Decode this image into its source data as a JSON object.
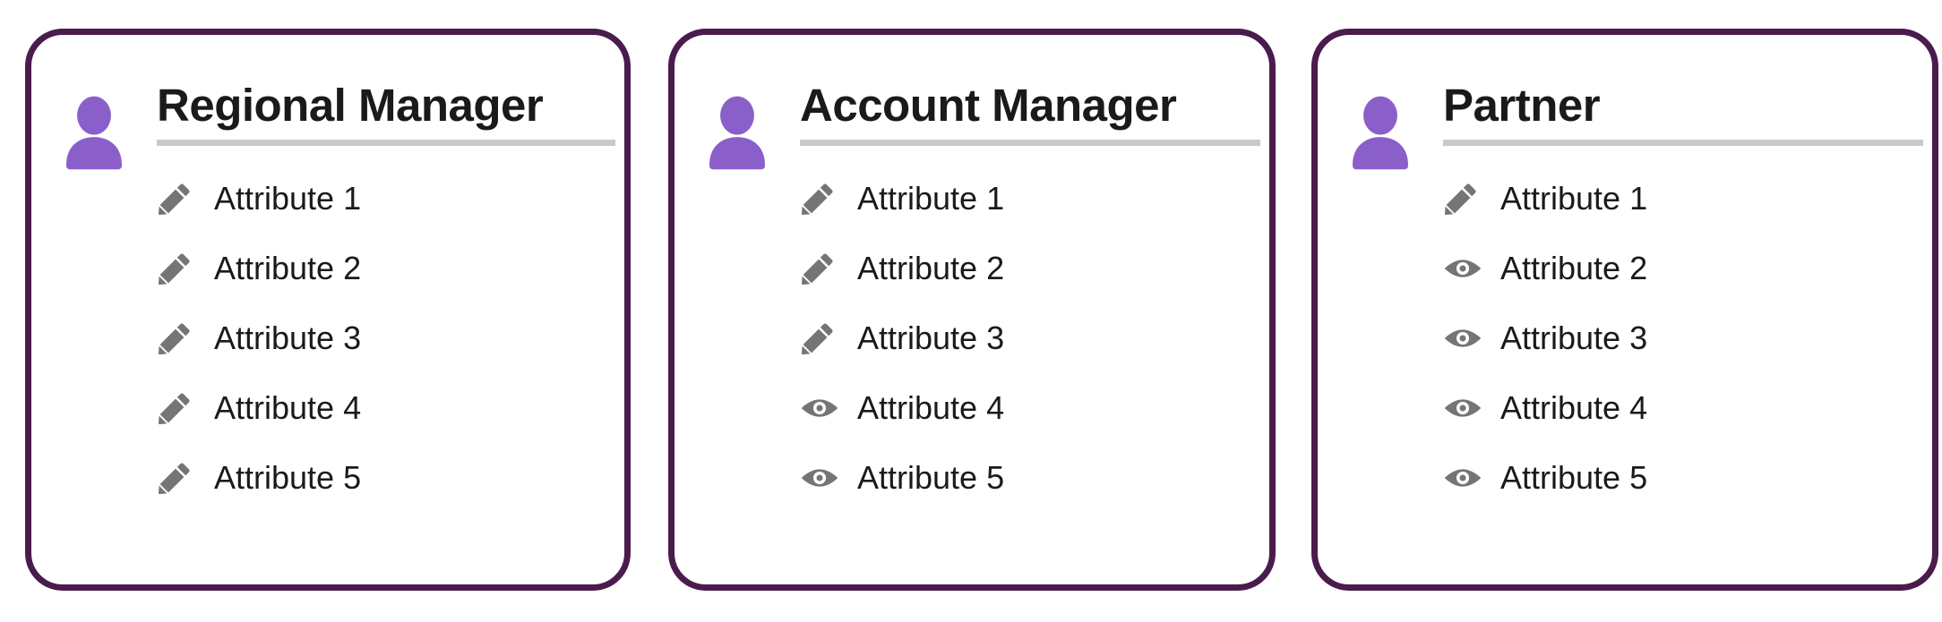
{
  "colors": {
    "card_border": "#4A1B4D",
    "avatar_purple": "#8B5FC9",
    "divider_gray": "#C9C9C9",
    "icon_gray": "#757575",
    "text_dark": "#1A1A1A",
    "background": "#FFFFFF"
  },
  "cards": [
    {
      "title": "Regional Manager",
      "avatar_icon": "person-icon",
      "attributes": [
        {
          "label": "Attribute 1",
          "icon": "pencil-icon"
        },
        {
          "label": "Attribute 2",
          "icon": "pencil-icon"
        },
        {
          "label": "Attribute 3",
          "icon": "pencil-icon"
        },
        {
          "label": "Attribute 4",
          "icon": "pencil-icon"
        },
        {
          "label": "Attribute 5",
          "icon": "pencil-icon"
        }
      ]
    },
    {
      "title": "Account Manager",
      "avatar_icon": "person-icon",
      "attributes": [
        {
          "label": "Attribute 1",
          "icon": "pencil-icon"
        },
        {
          "label": "Attribute 2",
          "icon": "pencil-icon"
        },
        {
          "label": "Attribute 3",
          "icon": "pencil-icon"
        },
        {
          "label": "Attribute 4",
          "icon": "eye-icon"
        },
        {
          "label": "Attribute 5",
          "icon": "eye-icon"
        }
      ]
    },
    {
      "title": "Partner",
      "avatar_icon": "person-icon",
      "attributes": [
        {
          "label": "Attribute 1",
          "icon": "pencil-icon"
        },
        {
          "label": "Attribute 2",
          "icon": "eye-icon"
        },
        {
          "label": "Attribute 3",
          "icon": "eye-icon"
        },
        {
          "label": "Attribute 4",
          "icon": "eye-icon"
        },
        {
          "label": "Attribute 5",
          "icon": "eye-icon"
        }
      ]
    }
  ]
}
